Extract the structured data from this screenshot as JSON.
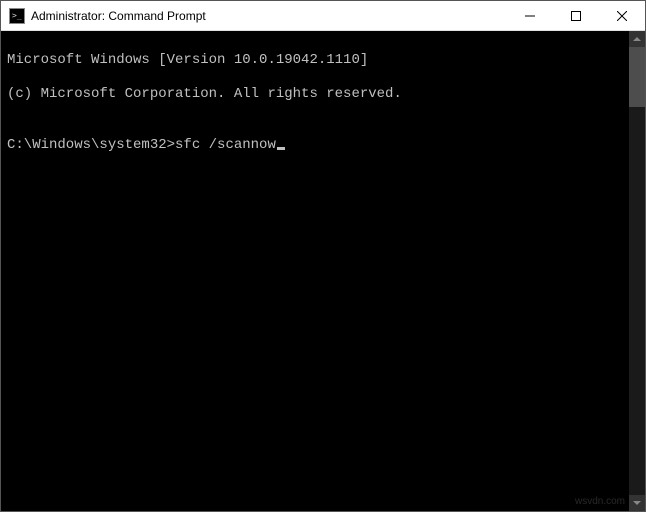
{
  "window": {
    "title": "Administrator: Command Prompt",
    "icon": "cmd-icon"
  },
  "console": {
    "header_line1": "Microsoft Windows [Version 10.0.19042.1110]",
    "header_line2": "(c) Microsoft Corporation. All rights reserved.",
    "blank": "",
    "prompt": "C:\\Windows\\system32>",
    "command": "sfc /scannow"
  },
  "watermark": "wsvdn.com"
}
